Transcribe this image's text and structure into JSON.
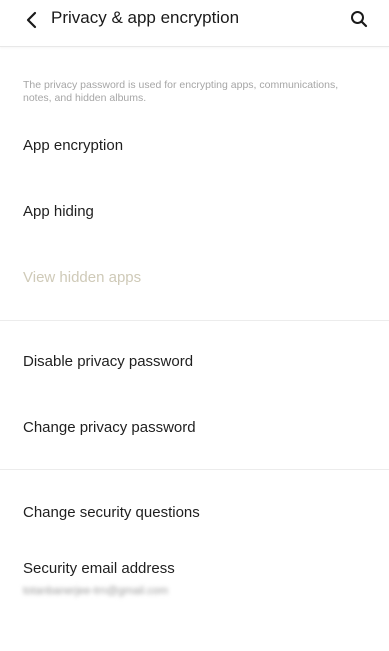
{
  "header": {
    "title": "Privacy & app encryption"
  },
  "description": "The privacy password is used for encrypting apps, communications, notes, and hidden albums.",
  "items": [
    {
      "label": "App encryption"
    },
    {
      "label": "App hiding"
    },
    {
      "label": "View hidden apps",
      "enabled": false
    },
    {
      "label": "Disable privacy password"
    },
    {
      "label": "Change privacy password"
    },
    {
      "label": "Change security questions"
    },
    {
      "label": "Security email address",
      "value": "totanbanerjee-trn@gmail.com"
    }
  ],
  "icons": {
    "back": "chevron-left-icon",
    "search": "search-icon"
  },
  "colors": {
    "disabled_text": "#cfcab8",
    "primary_text": "#1f1f1f",
    "secondary_text": "#a6a6a6"
  }
}
